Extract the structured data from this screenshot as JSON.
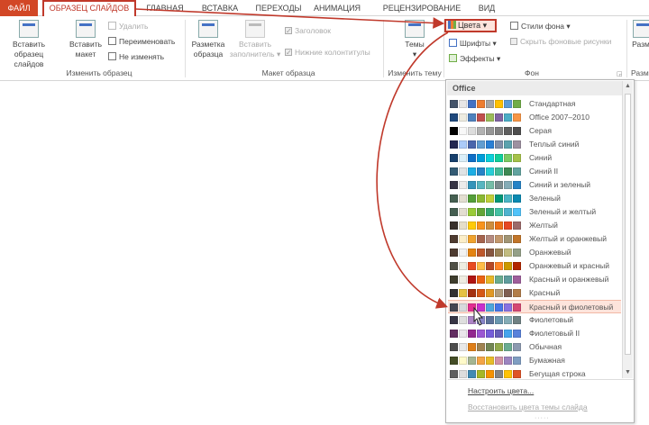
{
  "tabs": {
    "file": "ФАЙЛ",
    "slide_master": "ОБРАЗЕЦ СЛАЙДОВ",
    "home": "ГЛАВНАЯ",
    "insert": "ВСТАВКА",
    "transitions": "ПЕРЕХОДЫ",
    "animations": "АНИМАЦИЯ",
    "review": "РЕЦЕНЗИРОВАНИЕ",
    "view": "ВИД"
  },
  "ribbon": {
    "edit_master": {
      "label": "Изменить образец",
      "insert_slide_master": [
        "Вставить",
        "образец слайдов"
      ],
      "insert_layout": [
        "Вставить",
        "макет"
      ],
      "delete": "Удалить",
      "rename": "Переименовать",
      "preserve": "Не изменять"
    },
    "master_layout": {
      "label": "Макет образца",
      "master_layout": [
        "Разметка",
        "образца"
      ],
      "insert_placeholder": [
        "Вставить",
        "заполнитель"
      ],
      "title": "Заголовок",
      "footers": "Нижние колонтитулы"
    },
    "edit_theme": {
      "label": "Изменить тему",
      "themes": "Темы"
    },
    "background": {
      "label": "Фон",
      "colors": "Цвета",
      "fonts": "Шрифты",
      "effects": "Эффекты",
      "background_styles": "Стили фона",
      "hide_background": "Скрыть фоновые рисунки"
    },
    "size": {
      "label": "Разм",
      "slide_size": "Разм"
    }
  },
  "dropdown": {
    "header": "Office",
    "items": [
      {
        "name": "Стандартная",
        "colors": [
          "#44546a",
          "#e7e6e6",
          "#4472c4",
          "#ed7d31",
          "#a5a5a5",
          "#ffc000",
          "#5b9bd5",
          "#70ad47"
        ]
      },
      {
        "name": "Office 2007–2010",
        "colors": [
          "#1f497d",
          "#eeece1",
          "#4f81bd",
          "#c0504d",
          "#9bbb59",
          "#8064a2",
          "#4bacc6",
          "#f79646"
        ]
      },
      {
        "name": "Серая",
        "colors": [
          "#000000",
          "#f8f8f8",
          "#dddddd",
          "#b2b2b2",
          "#969696",
          "#808080",
          "#5f5f5f",
          "#4d4d4d"
        ]
      },
      {
        "name": "Теплый синий",
        "colors": [
          "#242852",
          "#accbf9",
          "#4a66ac",
          "#629dd1",
          "#297fd5",
          "#7f8fa9",
          "#5aa2ae",
          "#9d90a0"
        ]
      },
      {
        "name": "Синий",
        "colors": [
          "#17406d",
          "#dbeff9",
          "#0f6fc6",
          "#009dd9",
          "#0bd0d9",
          "#10cf9b",
          "#7cca62",
          "#a5c249"
        ]
      },
      {
        "name": "Синий II",
        "colors": [
          "#335b74",
          "#dfe3e5",
          "#1cade4",
          "#2683c6",
          "#27ced7",
          "#42ba97",
          "#3e8853",
          "#62a39f"
        ]
      },
      {
        "name": "Синий и зеленый",
        "colors": [
          "#373545",
          "#ebebeb",
          "#3494ba",
          "#58b6c0",
          "#75bda7",
          "#7a8c8e",
          "#84acb6",
          "#2683c6"
        ]
      },
      {
        "name": "Зеленый",
        "colors": [
          "#455f51",
          "#e3ded1",
          "#549e39",
          "#8ab833",
          "#c0cf3a",
          "#029676",
          "#4ab5c4",
          "#0989b1"
        ]
      },
      {
        "name": "Зеленый и желтый",
        "colors": [
          "#455f51",
          "#e3ded1",
          "#99cb38",
          "#63a537",
          "#37a76f",
          "#44c1a3",
          "#4eb3cf",
          "#51c3f9"
        ]
      },
      {
        "name": "Желтый",
        "colors": [
          "#39302a",
          "#e5dec9",
          "#ffca08",
          "#f8931d",
          "#ce8d3e",
          "#ec7016",
          "#e64823",
          "#9c6a6a"
        ]
      },
      {
        "name": "Желтый и оранжевый",
        "colors": [
          "#4e3b30",
          "#fbeec9",
          "#f0a22e",
          "#a5644e",
          "#b58b80",
          "#c3986d",
          "#a19574",
          "#c17529"
        ]
      },
      {
        "name": "Оранжевый",
        "colors": [
          "#4e3b30",
          "#f2f2f2",
          "#e48312",
          "#bd582c",
          "#865640",
          "#9b8357",
          "#c2bc80",
          "#94a088"
        ]
      },
      {
        "name": "Оранжевый и красный",
        "colors": [
          "#505046",
          "#eeece1",
          "#e84c22",
          "#ffbd47",
          "#b64926",
          "#ff8427",
          "#cc9900",
          "#b22600"
        ]
      },
      {
        "name": "Красный и оранжевый",
        "colors": [
          "#3e3d2d",
          "#eeece1",
          "#b01513",
          "#ea6312",
          "#e6b729",
          "#6aac90",
          "#5f9c9d",
          "#9e5e9b"
        ]
      },
      {
        "name": "Красный",
        "colors": [
          "#323232",
          "#e5c243",
          "#a5300f",
          "#d55816",
          "#e19825",
          "#b19c7d",
          "#7f5f52",
          "#b27d49"
        ]
      },
      {
        "name": "Красный и фиолетовый",
        "colors": [
          "#454551",
          "#d8d9dc",
          "#e32d91",
          "#c830cc",
          "#4ea6dc",
          "#4775e7",
          "#8971e1",
          "#d54773"
        ]
      },
      {
        "name": "Фиолетовый",
        "colors": [
          "#373545",
          "#dedede",
          "#ad84c6",
          "#8784c7",
          "#5d739a",
          "#6997af",
          "#84acb6",
          "#6f8183"
        ]
      },
      {
        "name": "Фиолетовый II",
        "colors": [
          "#632e62",
          "#eae5eb",
          "#92278f",
          "#9b57d3",
          "#755dd9",
          "#665eb8",
          "#45a5ed",
          "#5982db"
        ]
      },
      {
        "name": "Обычная",
        "colors": [
          "#4d4d4d",
          "#e8e8e8",
          "#de7e18",
          "#9f8351",
          "#728653",
          "#92aa4c",
          "#6aac91",
          "#8c9ab0"
        ]
      },
      {
        "name": "Бумажная",
        "colors": [
          "#444d26",
          "#fefac9",
          "#a5b592",
          "#f3a447",
          "#e7bc29",
          "#d092a7",
          "#9c85c0",
          "#809ec2"
        ]
      },
      {
        "name": "Бегущая строка",
        "colors": [
          "#5e5e5e",
          "#dddddd",
          "#418ab3",
          "#a6b727",
          "#f69200",
          "#838383",
          "#fec306",
          "#df5327"
        ]
      }
    ],
    "highlight_index": 15,
    "customize": "Настроить цвета...",
    "reset": "Восстановить цвета темы слайда"
  },
  "colors": {
    "accent": "#c0392b",
    "file_tab": "#d24726",
    "highlight": "#fde4dc"
  }
}
